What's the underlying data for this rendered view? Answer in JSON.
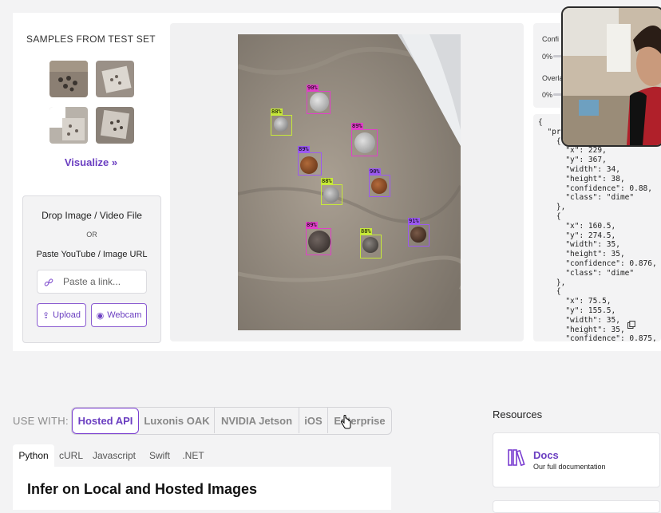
{
  "samples": {
    "title": "SAMPLES FROM TEST SET",
    "visualize_label": "Visualize »"
  },
  "upload": {
    "drop_label": "Drop Image / Video File",
    "or_label": "OR",
    "paste_label": "Paste YouTube / Image URL",
    "link_placeholder": "Paste a link...",
    "upload_label": "Upload",
    "webcam_label": "Webcam"
  },
  "detections": [
    {
      "label": "90%",
      "color": "#e040c8"
    },
    {
      "label": "88%",
      "color": "#c8ea3a"
    },
    {
      "label": "89%",
      "color": "#e040c8"
    },
    {
      "label": "89%",
      "color": "#9b59f0"
    },
    {
      "label": "88%",
      "color": "#c8ea3a"
    },
    {
      "label": "90%",
      "color": "#9b59f0"
    },
    {
      "label": "89%",
      "color": "#e040c8"
    },
    {
      "label": "88%",
      "color": "#c8ea3a"
    },
    {
      "label": "91%",
      "color": "#9b59f0"
    }
  ],
  "controls": {
    "confidence_label": "Confi",
    "confidence_value": "0%",
    "confidence_level": 0.0,
    "overlap_label": "Overla",
    "overlap_value": "0%",
    "overlap_level": 0.0
  },
  "json_output": "{\n  \"pre\n    {\n      \"x\": 229,\n      \"y\": 367,\n      \"width\": 34,\n      \"height\": 38,\n      \"confidence\": 0.88,\n      \"class\": \"dime\"\n    },\n    {\n      \"x\": 160.5,\n      \"y\": 274.5,\n      \"width\": 35,\n      \"height\": 35,\n      \"confidence\": 0.876,\n      \"class\": \"dime\"\n    },\n    {\n      \"x\": 75.5,\n      \"y\": 155.5,\n      \"width\": 35,\n      \"height\": 35,\n      \"confidence\": 0.875,",
  "deploy": {
    "use_with_label": "USE WITH:",
    "options": [
      "Hosted API",
      "Luxonis OAK",
      "NVIDIA Jetson",
      "iOS",
      "Enterprise"
    ],
    "selected": "Hosted API",
    "languages": [
      "Python",
      "cURL",
      "Javascript",
      "Swift",
      ".NET"
    ],
    "selected_language": "Python",
    "heading": "Infer on Local and Hosted Images"
  },
  "resources": {
    "title": "Resources",
    "docs_title": "Docs",
    "docs_subtitle": "Our full documentation"
  },
  "colors": {
    "accent": "#7b3fd1",
    "page_bg": "#f3f3f4"
  }
}
